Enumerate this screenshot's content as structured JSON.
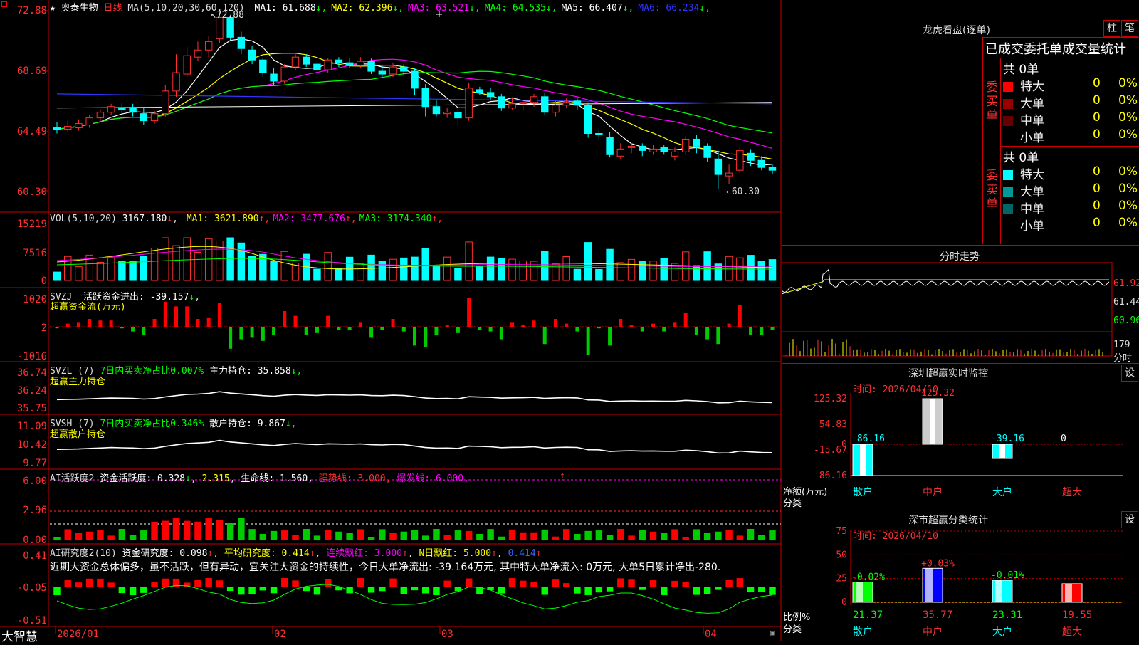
{
  "header": {
    "star": "★",
    "stock_name": "奥泰生物",
    "period": "日线",
    "ma_spec": "MA(5,10,20,30,60,120)",
    "ma_items": [
      {
        "label": "MA1:",
        "value": "61.688",
        "arrow": "↓",
        "color": "#ffffff"
      },
      {
        "label": "MA2:",
        "value": "62.396",
        "arrow": "↓",
        "color": "#ffff00"
      },
      {
        "label": "MA3:",
        "value": "63.521",
        "arrow": "↓",
        "color": "#ff00ff"
      },
      {
        "label": "MA4:",
        "value": "64.535",
        "arrow": "↓",
        "color": "#00ff00"
      },
      {
        "label": "MA5:",
        "value": "66.407",
        "arrow": "↓",
        "color": "#ffffff"
      },
      {
        "label": "MA6:",
        "value": "66.234",
        "arrow": "↓",
        "color": "#3333ff"
      }
    ],
    "high_marker": "72.88",
    "low_marker": "60.30"
  },
  "price_axis": [
    "72.88",
    "68.69",
    "64.49",
    "60.30"
  ],
  "vol": {
    "title": "VOL(5,10,20)",
    "value": "3167.180",
    "items": [
      {
        "label": "MA1:",
        "value": "3621.890",
        "arrow": "↑",
        "color": "#ffff00"
      },
      {
        "label": "MA2:",
        "value": "3477.676",
        "arrow": "↑",
        "color": "#ff00ff"
      },
      {
        "label": "MA3:",
        "value": "3174.340",
        "arrow": "↑",
        "color": "#00ff00"
      }
    ],
    "axis": [
      "15219",
      "7516",
      "0"
    ]
  },
  "svzj": {
    "title": "SVZJ",
    "label": "活跃资金进出:",
    "value": "-39.157",
    "arrow": "↓",
    "subtitle": "超赢资金流(万元)",
    "axis": [
      "1020",
      "2",
      "-1016"
    ]
  },
  "svzl": {
    "title": "SVZL (7)",
    "label": "7日内买卖净占比0.007%",
    "hold": "主力持仓: 35.858",
    "arrow": "↓,",
    "subtitle": "超赢主力持仓",
    "axis": [
      "36.74",
      "36.24",
      "35.75"
    ]
  },
  "svsh": {
    "title": "SVSH (7)",
    "label": "7日内买卖净占比0.346%",
    "hold": "散户持仓: 9.867",
    "arrow": "↓,",
    "subtitle": "超赢散户持仓",
    "axis": [
      "11.09",
      "10.42",
      "9.77"
    ]
  },
  "ai_active": {
    "title": "AI活跃度2",
    "label": "资金活跃度: 0.328",
    "v2": "2.315",
    "life": "生命线: 1.560,",
    "strong": "强势线: 3.000,",
    "burst": "爆发线: 6.000,",
    "axis": [
      "6.00",
      "2.96",
      "0.00"
    ]
  },
  "ai_research": {
    "title": "AI研究度2(10)",
    "label": "资金研究度: 0.098",
    "avg": "平均研究度: 0.414",
    "streak": "连续飘红: 3.000",
    "nday": "N日飘红: 5.000",
    "last": "0.414",
    "comment": "近期大资金总体偏多，虽不活跃，但有异动，宜关注大资金的持续性，今日大单净流出: -39.164万元, 其中特大单净流入: 0万元, 大单5日累计净出-280.",
    "axis": [
      "0.41",
      "-0.05",
      "-0.51"
    ]
  },
  "x_axis": [
    "2026/01",
    "02",
    "03",
    "04"
  ],
  "brand": "大智慧",
  "right": {
    "dragon_title": "龙虎看盘(逐单)",
    "btn_zhu": "柱",
    "btn_bi": "笔",
    "stat_title": "已成交委托单成交量统计",
    "buy_label": "委买单",
    "sell_label": "委卖单",
    "buy_total": "共 0单",
    "sell_total": "共 0单",
    "buy_rows": [
      {
        "name": "特大",
        "count": "0",
        "pct": "0%",
        "color": "#ff0000"
      },
      {
        "name": "大单",
        "count": "0",
        "pct": "0%",
        "color": "#990000"
      },
      {
        "name": "中单",
        "count": "0",
        "pct": "0%",
        "color": "#660000"
      },
      {
        "name": "小单",
        "count": "0",
        "pct": "0%",
        "color": "#000000"
      }
    ],
    "sell_rows": [
      {
        "name": "特大",
        "count": "0",
        "pct": "0%",
        "color": "#00ffff"
      },
      {
        "name": "大单",
        "count": "0",
        "pct": "0%",
        "color": "#009999"
      },
      {
        "name": "中单",
        "count": "0",
        "pct": "0%",
        "color": "#006666"
      },
      {
        "name": "小单",
        "count": "0",
        "pct": "0%",
        "color": "#000000"
      }
    ],
    "intraday_title": "分时走势",
    "intraday_axis": [
      "61.92",
      "61.44",
      "60.96"
    ],
    "intraday_vol": "179",
    "intraday_vol_label": "分时",
    "monitor_title": "深圳超赢实时监控",
    "monitor_time": "时间: 2026/04/10",
    "monitor_btn": "设",
    "monitor_axis": [
      "125.32",
      "54.83",
      "0",
      "-15.67",
      "-86.16"
    ],
    "monitor_unit": "净额(万元)",
    "monitor_cat": "分类",
    "monitor_bars": [
      {
        "name": "散户",
        "value": "-86.16"
      },
      {
        "name": "中户",
        "value": "125.32"
      },
      {
        "name": "大户",
        "value": "-39.16"
      },
      {
        "name": "超大",
        "value": "0"
      }
    ],
    "class_title": "深市超赢分类统计",
    "class_time": "时间: 2026/04/10",
    "class_btn": "设",
    "class_axis": [
      "75",
      "50",
      "25",
      "0"
    ],
    "class_unit": "比例%",
    "class_cat": "分类",
    "class_bars": [
      {
        "name": "散户",
        "value": "21.37",
        "change": "-0.02%"
      },
      {
        "name": "中户",
        "value": "35.77",
        "change": "+0.03%"
      },
      {
        "name": "大户",
        "value": "23.31",
        "change": "-0.01%"
      },
      {
        "name": "超大",
        "value": "19.55",
        "change": ""
      }
    ]
  },
  "chart_data": {
    "type": "candlestick",
    "x": [
      "2026/01",
      "02",
      "03",
      "04"
    ],
    "ylim": [
      60.3,
      72.88
    ],
    "candles": [
      [
        64.6,
        64.5,
        65.0,
        64.2
      ],
      [
        64.5,
        64.7,
        65.1,
        64.3
      ],
      [
        64.6,
        64.9,
        65.2,
        64.4
      ],
      [
        64.8,
        65.3,
        65.5,
        64.6
      ],
      [
        65.3,
        65.7,
        65.9,
        65.1
      ],
      [
        65.7,
        66.1,
        66.3,
        65.5
      ],
      [
        66.0,
        65.9,
        66.4,
        65.5
      ],
      [
        66.0,
        65.7,
        66.3,
        65.4
      ],
      [
        65.6,
        65.1,
        66.0,
        64.8
      ],
      [
        65.1,
        65.6,
        65.8,
        64.9
      ],
      [
        65.6,
        67.2,
        67.6,
        65.4
      ],
      [
        67.2,
        68.5,
        69.8,
        66.8
      ],
      [
        68.4,
        69.7,
        70.3,
        68.2
      ],
      [
        69.6,
        70.1,
        70.7,
        69.3
      ],
      [
        70.1,
        70.7,
        71.1,
        69.6
      ],
      [
        70.9,
        72.4,
        72.88,
        70.6
      ],
      [
        72.4,
        71.0,
        72.6,
        70.8
      ],
      [
        71.0,
        70.2,
        71.4,
        69.8
      ],
      [
        70.1,
        69.4,
        70.4,
        69.1
      ],
      [
        69.4,
        68.5,
        69.6,
        68.2
      ],
      [
        68.4,
        67.9,
        68.8,
        67.6
      ],
      [
        67.9,
        68.9,
        69.1,
        67.7
      ],
      [
        68.9,
        69.6,
        69.8,
        68.7
      ],
      [
        69.6,
        69.1,
        69.8,
        68.9
      ],
      [
        69.1,
        68.7,
        69.3,
        68.3
      ],
      [
        68.7,
        69.4,
        69.5,
        68.5
      ],
      [
        69.4,
        69.2,
        69.6,
        68.9
      ],
      [
        69.2,
        69.0,
        69.5,
        68.8
      ],
      [
        69.0,
        69.3,
        69.6,
        68.8
      ],
      [
        69.3,
        68.6,
        69.5,
        68.4
      ],
      [
        68.6,
        68.4,
        69.0,
        68.1
      ],
      [
        68.4,
        68.9,
        69.2,
        68.2
      ],
      [
        68.9,
        68.6,
        69.1,
        68.3
      ],
      [
        68.6,
        67.4,
        68.8,
        66.9
      ],
      [
        67.4,
        66.1,
        67.7,
        65.4
      ],
      [
        66.1,
        65.6,
        66.6,
        65.4
      ],
      [
        65.6,
        65.7,
        66.0,
        65.3
      ],
      [
        65.7,
        65.3,
        66.1,
        64.8
      ],
      [
        65.3,
        67.4,
        67.8,
        65.1
      ],
      [
        67.3,
        67.1,
        67.5,
        66.9
      ],
      [
        67.1,
        66.8,
        67.4,
        66.6
      ],
      [
        66.8,
        66.0,
        67.0,
        65.8
      ],
      [
        66.0,
        66.3,
        66.7,
        65.9
      ],
      [
        66.3,
        66.4,
        66.6,
        65.8
      ],
      [
        66.4,
        66.8,
        67.0,
        66.1
      ],
      [
        66.8,
        65.7,
        67.1,
        65.5
      ],
      [
        65.7,
        66.2,
        66.5,
        65.4
      ],
      [
        66.2,
        66.4,
        66.7,
        66.0
      ],
      [
        66.5,
        66.2,
        66.7,
        65.9
      ],
      [
        66.2,
        64.2,
        66.4,
        63.9
      ],
      [
        64.2,
        64.1,
        64.5,
        63.7
      ],
      [
        63.9,
        62.7,
        64.3,
        62.5
      ],
      [
        62.6,
        63.1,
        63.5,
        62.4
      ],
      [
        63.2,
        63.3,
        63.5,
        62.8
      ],
      [
        63.3,
        63.0,
        63.5,
        62.6
      ],
      [
        62.9,
        63.1,
        63.4,
        62.7
      ],
      [
        63.2,
        62.9,
        63.4,
        62.7
      ],
      [
        62.6,
        62.9,
        63.2,
        62.3
      ],
      [
        62.9,
        63.8,
        64.0,
        62.7
      ],
      [
        63.8,
        63.3,
        64.1,
        62.8
      ],
      [
        63.3,
        62.5,
        63.5,
        62.2
      ],
      [
        62.4,
        61.3,
        63.0,
        60.3
      ],
      [
        61.2,
        61.4,
        62.0,
        60.6
      ],
      [
        61.6,
        63.0,
        63.2,
        61.4
      ],
      [
        62.8,
        62.3,
        63.1,
        61.9
      ],
      [
        62.3,
        61.8,
        62.6,
        61.6
      ],
      [
        61.8,
        61.6,
        62.0,
        61.3
      ]
    ]
  }
}
